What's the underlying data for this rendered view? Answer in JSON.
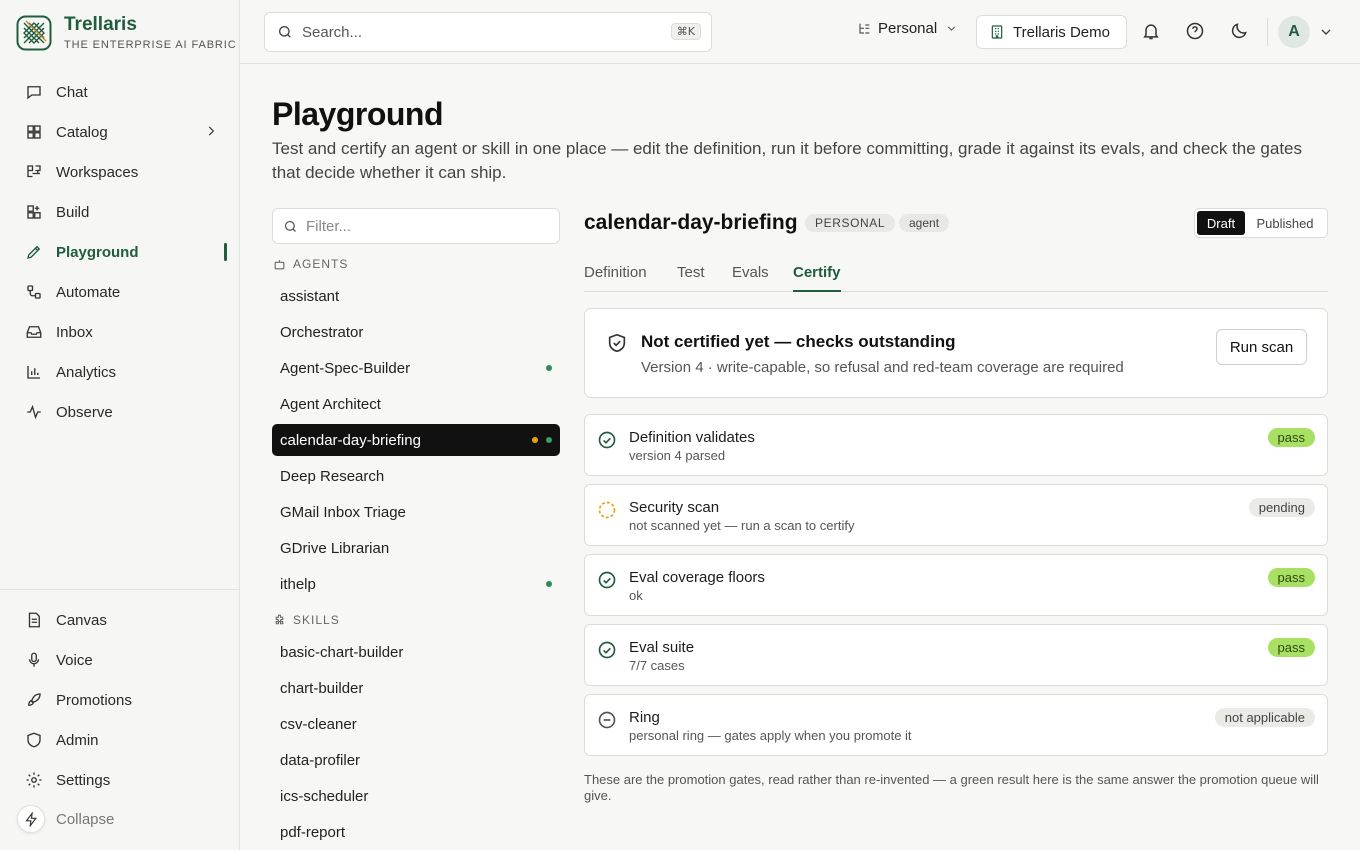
{
  "brand": {
    "name": "Trellaris",
    "tagline": "THE ENTERPRISE AI FABRIC"
  },
  "sidebar": {
    "items": [
      {
        "label": "Chat",
        "icon": "chat-icon"
      },
      {
        "label": "Catalog",
        "icon": "grid-icon"
      },
      {
        "label": "Workspaces",
        "icon": "workspaces-icon"
      },
      {
        "label": "Build",
        "icon": "build-icon"
      },
      {
        "label": "Playground",
        "icon": "pencil-icon",
        "active": true
      },
      {
        "label": "Automate",
        "icon": "automate-icon"
      },
      {
        "label": "Inbox",
        "icon": "inbox-icon"
      },
      {
        "label": "Analytics",
        "icon": "analytics-icon"
      },
      {
        "label": "Observe",
        "icon": "pulse-icon"
      }
    ],
    "bottom_items": [
      {
        "label": "Canvas",
        "icon": "file-icon"
      },
      {
        "label": "Voice",
        "icon": "mic-icon"
      },
      {
        "label": "Promotions",
        "icon": "rocket-icon"
      },
      {
        "label": "Admin",
        "icon": "shield-icon"
      },
      {
        "label": "Settings",
        "icon": "gear-icon"
      }
    ],
    "collapse_label": "Collapse"
  },
  "header": {
    "search_placeholder": "Search...",
    "search_shortcut": "⌘K",
    "workspace": "Personal",
    "org": "Trellaris Demo",
    "avatar_initial": "A"
  },
  "page": {
    "title": "Playground",
    "description": "Test and certify an agent or skill in one place — edit the definition, run it before committing, grade it against its evals, and check the gates that decide whether it can ship."
  },
  "list": {
    "filter_placeholder": "Filter...",
    "agents_label": "AGENTS",
    "agents": [
      {
        "name": "assistant",
        "dots": []
      },
      {
        "name": "Orchestrator",
        "dots": []
      },
      {
        "name": "Agent-Spec-Builder",
        "dots": [
          "green"
        ]
      },
      {
        "name": "Agent Architect",
        "dots": []
      },
      {
        "name": "calendar-day-briefing",
        "dots": [
          "amber",
          "green"
        ],
        "selected": true
      },
      {
        "name": "Deep Research",
        "dots": []
      },
      {
        "name": "GMail Inbox Triage",
        "dots": []
      },
      {
        "name": "GDrive Librarian",
        "dots": []
      },
      {
        "name": "ithelp",
        "dots": [
          "green"
        ]
      }
    ],
    "skills_label": "SKILLS",
    "skills": [
      {
        "name": "basic-chart-builder"
      },
      {
        "name": "chart-builder"
      },
      {
        "name": "csv-cleaner"
      },
      {
        "name": "data-profiler"
      },
      {
        "name": "ics-scheduler"
      },
      {
        "name": "pdf-report"
      }
    ]
  },
  "detail": {
    "title": "calendar-day-briefing",
    "scope_badge": "PERSONAL",
    "kind_badge": "agent",
    "toggle": {
      "draft": "Draft",
      "published": "Published",
      "selected": "Draft"
    },
    "tabs": [
      "Definition",
      "Test",
      "Evals",
      "Certify"
    ],
    "active_tab": "Certify",
    "cert": {
      "title": "Not certified yet — checks outstanding",
      "subtitle": "Version 4 · write-capable, so refusal and red-team coverage are required",
      "run_button": "Run scan"
    },
    "gates": [
      {
        "name": "Definition validates",
        "detail": "version 4 parsed",
        "status": "pass",
        "icon": "check-circle-icon"
      },
      {
        "name": "Security scan",
        "detail": "not scanned yet — run a scan to certify",
        "status": "pending",
        "icon": "pending-circle-icon"
      },
      {
        "name": "Eval coverage floors",
        "detail": "ok",
        "status": "pass",
        "icon": "check-circle-icon"
      },
      {
        "name": "Eval suite",
        "detail": "7/7 cases",
        "status": "pass",
        "icon": "check-circle-icon"
      },
      {
        "name": "Ring",
        "detail": "personal ring — gates apply when you promote it",
        "status": "not applicable",
        "icon": "minus-circle-icon"
      }
    ],
    "footnote": "These are the promotion gates, read rather than re-invented — a green result here is the same answer the promotion queue will give."
  },
  "colors": {
    "accent": "#1f5d3e",
    "pass": "#a8e063",
    "pending": "#e5a50a",
    "dot_green": "#2e8b57"
  }
}
